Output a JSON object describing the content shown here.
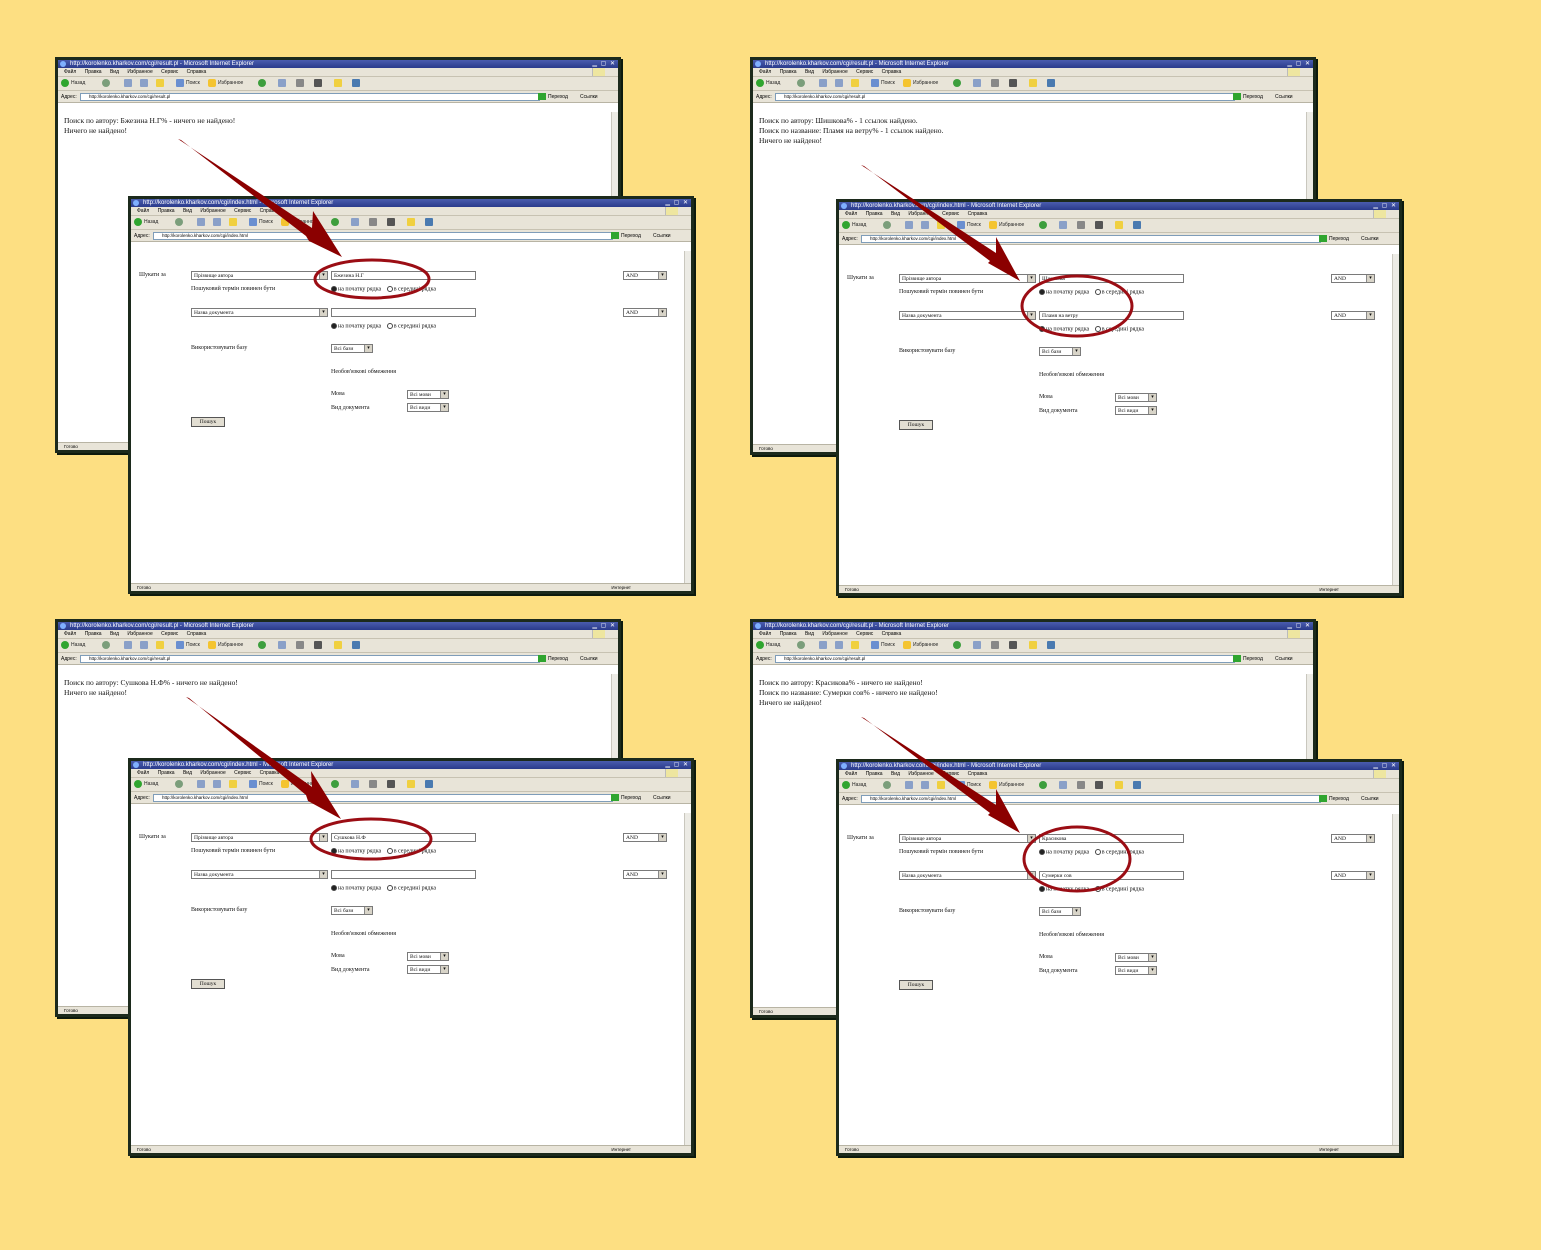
{
  "background_color": "#FDDF82",
  "accent_color": "#8B0000",
  "browser": {
    "menu_items": [
      "Файл",
      "Правка",
      "Вид",
      "Избранное",
      "Сервис",
      "Справка"
    ],
    "toolbar_back": "Назад",
    "toolbar_search": "Поиск",
    "toolbar_favorites": "Избранное",
    "address_label": "Адрес:",
    "go_label": "Переход",
    "links_label": "Ссылки",
    "status_done": "Готово",
    "status_zone": "Интернет",
    "result_url": "http://korolenko.kharkov.com/cgi/result.pl",
    "form_url": "http://korolenko.kharkov.com/cgi/index.html",
    "result_title": "http://korolenko.kharkov.com/cgi/result.pl - Microsoft Internet Explorer",
    "form_title": "http://korolenko.kharkov.com/cgi/index.html - Microsoft Internet Explorer"
  },
  "form_labels": {
    "search_in": "Шукати за",
    "field1": "Прізвище автора",
    "field2": "Назва документа",
    "term_search": "Пошуковий термін повинен бути",
    "radio_start": "на початку рядка",
    "radio_middle": "в середині рядка",
    "logic": "AND",
    "use_base": "Використовувати базу",
    "base_value": "Всі бази",
    "restrictions": "Необов'язкові обмеження",
    "lang": "Мова",
    "lang_value": "Всі мови",
    "doc_type": "Вид документа",
    "doc_type_value": "Всі види",
    "search_button": "Пошук"
  },
  "panels": [
    {
      "results": [
        "Поиск по автору: Бжезина Н.Г% - ничего не найдено!",
        "Ничего не найдено!"
      ],
      "author_value": "Бжезина Н.Г",
      "title_value": ""
    },
    {
      "results": [
        "Поиск по автору: Шишкова% - 1 ссылок найдено.",
        "Поиск по название: Пламя на ветру% - 1 ссылок найдено.",
        "Ничего не найдено!"
      ],
      "author_value": "Шишкова",
      "title_value": "Пламя на ветру"
    },
    {
      "results": [
        "Поиск по автору: Сушкова Н.Ф% - ничего не найдено!",
        "Ничего не найдено!"
      ],
      "author_value": "Сушкова Н.Ф",
      "title_value": ""
    },
    {
      "results": [
        "Поиск по автору: Красикова% - ничего не найдено!",
        "Поиск по название: Сумерки сов% - ничего не найдено!",
        "Ничего не найдено!"
      ],
      "author_value": "Красикова",
      "title_value": "Сумерки сов"
    }
  ]
}
